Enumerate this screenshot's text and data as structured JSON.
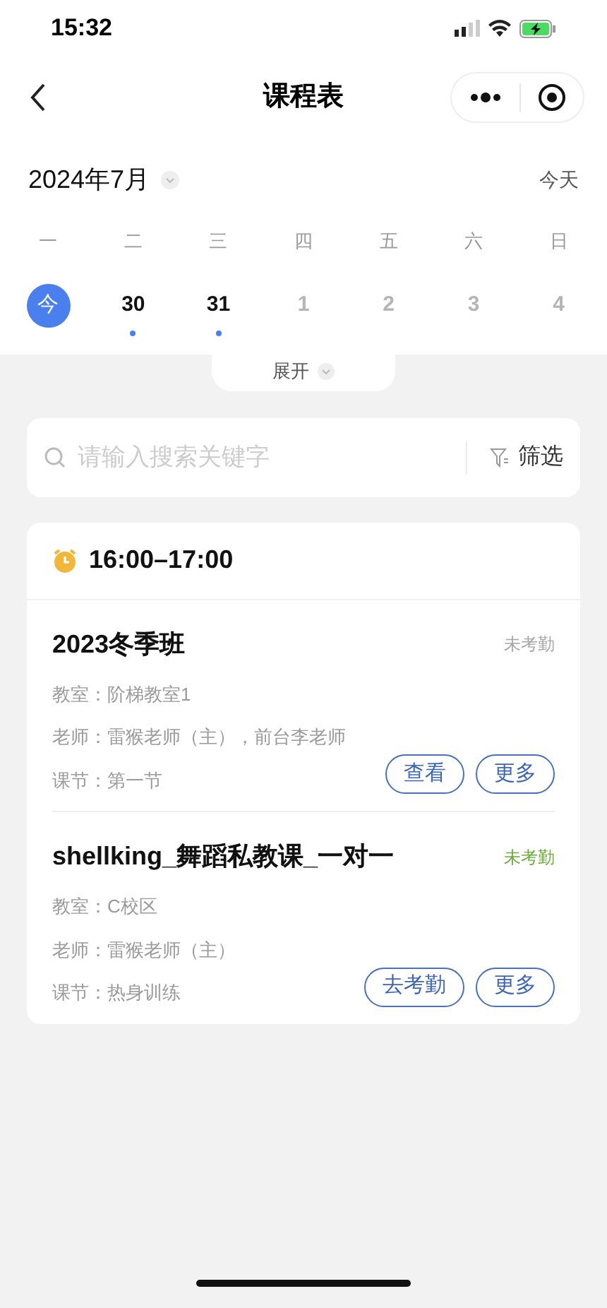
{
  "status_bar": {
    "time": "15:32"
  },
  "nav": {
    "title": "课程表"
  },
  "calendar": {
    "month": "2024年7月",
    "today_button": "今天",
    "weekdays": [
      "一",
      "二",
      "三",
      "四",
      "五",
      "六",
      "日"
    ],
    "days": [
      {
        "label": "今",
        "selected": true,
        "has_class": false,
        "dimmed": false
      },
      {
        "label": "30",
        "selected": false,
        "has_class": true,
        "dimmed": false
      },
      {
        "label": "31",
        "selected": false,
        "has_class": true,
        "dimmed": false
      },
      {
        "label": "1",
        "selected": false,
        "has_class": false,
        "dimmed": true
      },
      {
        "label": "2",
        "selected": false,
        "has_class": false,
        "dimmed": true
      },
      {
        "label": "3",
        "selected": false,
        "has_class": false,
        "dimmed": true
      },
      {
        "label": "4",
        "selected": false,
        "has_class": false,
        "dimmed": true
      }
    ],
    "expand": "展开"
  },
  "search": {
    "placeholder": "请输入搜索关键字",
    "filter": "筛选"
  },
  "schedule": {
    "time": "16:00–17:00",
    "lessons": [
      {
        "name": "2023冬季班",
        "status": "未考勤",
        "color": "#a6a6a6",
        "details": [
          "教室：阶梯教室1",
          "老师：雷猴老师（主），前台李老师",
          "课节：第一节"
        ],
        "buttons": [
          "查看",
          "更多"
        ]
      },
      {
        "name": "shellking_舞蹈私教课_一对一",
        "status": "未考勤",
        "color": "#6aad3a",
        "details": [
          "教室：C校区",
          "老师：雷猴老师（主）",
          "课节：热身训练"
        ],
        "buttons": [
          "去考勤",
          "更多"
        ]
      }
    ]
  }
}
